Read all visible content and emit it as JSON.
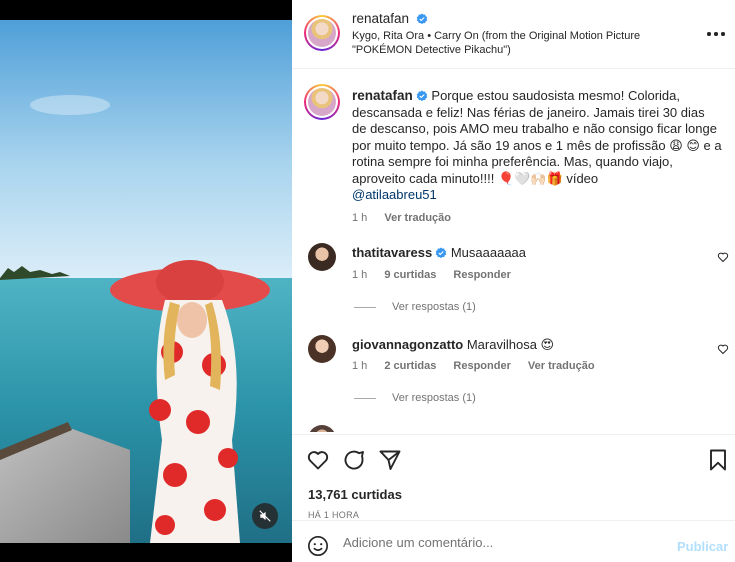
{
  "header": {
    "username": "renatafan",
    "audio": "Kygo, Rita Ora • Carry On (from the Original Motion Picture \"POKÉMON Detective Pikachu\")"
  },
  "caption": {
    "username": "renatafan",
    "text": "Porque estou saudosista mesmo! Colorida, descansada e feliz! Nas férias de janeiro. Jamais tirei 30 dias de descanso, pois AMO meu trabalho e não consigo ficar longe por muito tempo. Já são 19 anos e 1 mês de profissão 😩 😊 e a rotina sempre foi minha preferência. Mas, quando viajo, aproveito cada minuto!!!! 🎈🤍🙌🏻🎁 vídeo",
    "mention": "@atilaabreu51",
    "time": "1 h",
    "see_translation": "Ver tradução"
  },
  "comments": [
    {
      "username": "thatitavaress",
      "text": "Musaaaaaaa",
      "time": "1 h",
      "likes": "9 curtidas",
      "reply": "Responder",
      "view_replies": "Ver respostas (1)"
    },
    {
      "username": "giovannagonzatto",
      "text": "Maravilhosa 😍",
      "time": "1 h",
      "likes": "2 curtidas",
      "reply": "Responder",
      "see_translation": "Ver tradução",
      "view_replies": "Ver respostas (1)"
    }
  ],
  "stats": {
    "likes": "13,761 curtidas",
    "time_ago": "HÁ 1 HORA"
  },
  "add_comment": {
    "placeholder": "Adicione um comentário...",
    "publish": "Publicar"
  },
  "colors": {
    "verified": "#3897f0",
    "link": "#00376b",
    "publish_disabled": "#b2dffc",
    "secondary_text": "#737373"
  }
}
